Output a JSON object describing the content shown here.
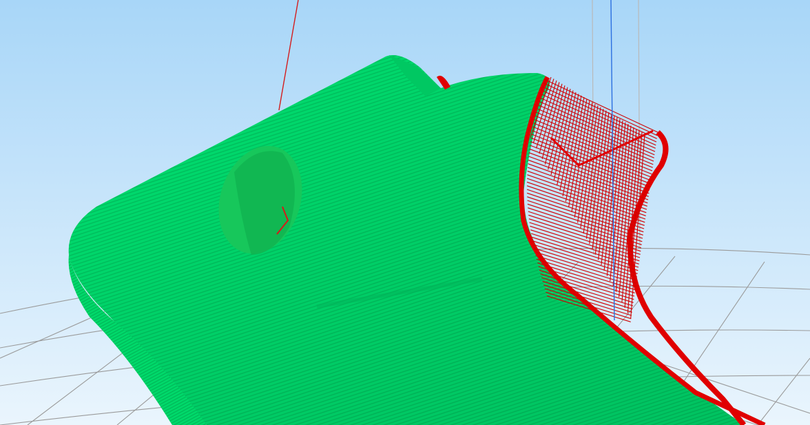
{
  "viewport": {
    "background_top": "#a8d6f8",
    "background_bottom": "#eaf5fd"
  },
  "model": {
    "shell_color": "#00e070",
    "shell_shade": "#00b85a",
    "support_color": "#e00000",
    "hole_color": "#18c95e"
  },
  "build_plate": {
    "grid_color": "#9a9a9a"
  },
  "axes": {
    "x_axis_color": "#d41c1c",
    "z_axis_color": "#2b6fe0",
    "guide_color": "#b9b9b9"
  }
}
